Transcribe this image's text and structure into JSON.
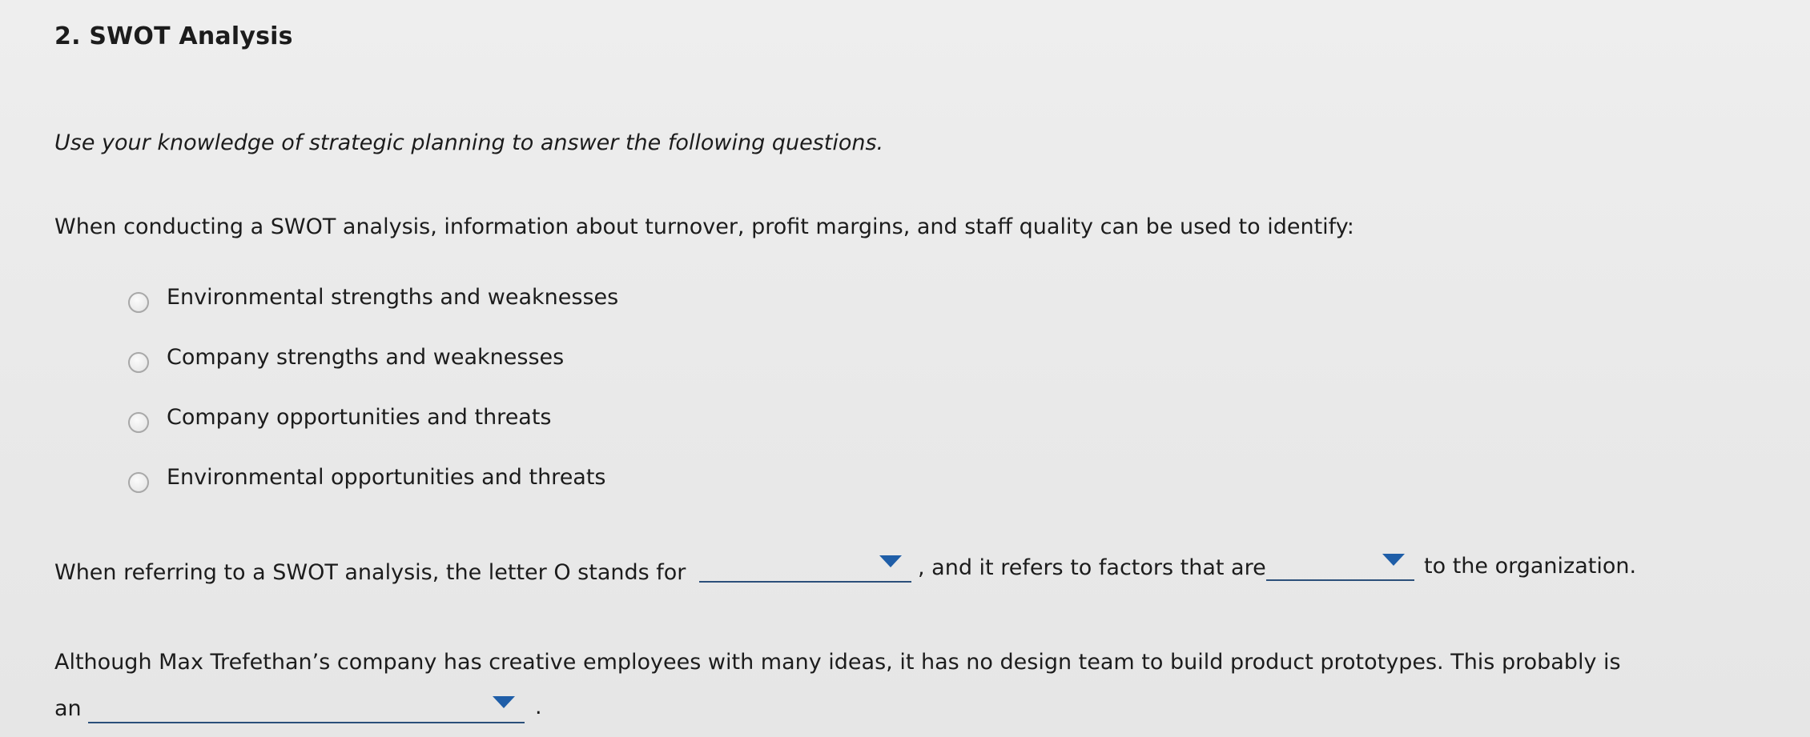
{
  "title": "2. SWOT Analysis",
  "intro": "Use your knowledge of strategic planning to answer the following questions.",
  "question1": {
    "text": "When conducting a SWOT analysis, information about turnover, profit margins, and staff quality can be used to identify:",
    "options": [
      "Environmental strengths and weaknesses",
      "Company strengths and weaknesses",
      "Company opportunities and threats",
      "Environmental opportunities and threats"
    ]
  },
  "question2": {
    "part1": "When referring to a SWOT analysis, the letter O stands for",
    "part2": ", and it refers to factors that are",
    "part3": "to the organization.",
    "dropdown1_value": "",
    "dropdown2_value": ""
  },
  "question3": {
    "line1": "Although Max Trefethan’s company has creative employees with many ideas, it has no design team to build product prototypes. This probably is",
    "line2_prefix": "an",
    "dropdown_value": "",
    "suffix": "."
  },
  "colors": {
    "background": "#ebebeb",
    "text": "#1c1c1c",
    "dropdown_caret": "#1f5ea8",
    "dropdown_underline": "#2b4f7a"
  }
}
